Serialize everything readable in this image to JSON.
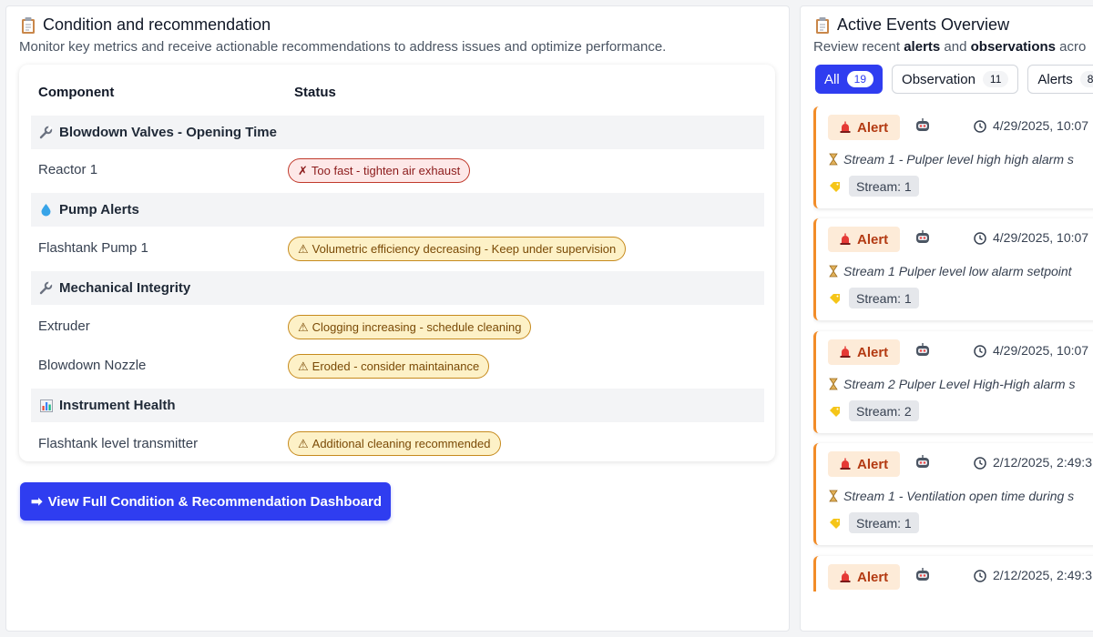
{
  "left": {
    "title": "Condition and recommendation",
    "subtitle": "Monitor key metrics and receive actionable recommendations to address issues and optimize performance.",
    "columns": {
      "component": "Component",
      "status": "Status"
    },
    "groups": [
      {
        "label": "Blowdown Valves - Opening Time",
        "icon": "wrench-icon"
      },
      {
        "label": "Pump Alerts",
        "icon": "droplet-icon"
      },
      {
        "label": "Mechanical Integrity",
        "icon": "wrench-icon"
      },
      {
        "label": "Instrument Health",
        "icon": "bar-chart-icon"
      }
    ],
    "rows": [
      {
        "component": "Reactor 1",
        "status": "Too fast - tighten air exhaust",
        "level": "error",
        "icon": "x-icon"
      },
      {
        "component": "Flashtank Pump 1",
        "status": "Volumetric efficiency decreasing - Keep under supervision",
        "level": "warning",
        "icon": "warning-icon"
      },
      {
        "component": "Extruder",
        "status": "Clogging increasing - schedule cleaning",
        "level": "warning",
        "icon": "warning-icon"
      },
      {
        "component": "Blowdown Nozzle",
        "status": "Eroded - consider maintainance",
        "level": "warning",
        "icon": "warning-icon"
      },
      {
        "component": "Flashtank level transmitter",
        "status": "Additional cleaning recommended",
        "level": "warning",
        "icon": "warning-icon"
      }
    ],
    "button_label": "View Full Condition & Recommendation Dashboard",
    "button_icon": "arrow-right-icon"
  },
  "right": {
    "title": "Active Events Overview",
    "subtitle_prefix": "Review recent ",
    "subtitle_bold1": "alerts",
    "subtitle_mid": " and ",
    "subtitle_bold2": "observations",
    "subtitle_suffix": " acro",
    "tabs": [
      {
        "label": "All",
        "count": "19",
        "active": true
      },
      {
        "label": "Observation",
        "count": "11",
        "active": false
      },
      {
        "label": "Alerts",
        "count": "8",
        "active": false
      }
    ],
    "events": [
      {
        "badge": "Alert",
        "time": "4/29/2025, 10:07",
        "desc": "Stream 1 - Pulper level high high alarm s",
        "stream": "Stream: 1"
      },
      {
        "badge": "Alert",
        "time": "4/29/2025, 10:07",
        "desc": "Stream 1 Pulper level low alarm setpoint",
        "stream": "Stream: 1"
      },
      {
        "badge": "Alert",
        "time": "4/29/2025, 10:07",
        "desc": "Stream 2 Pulper Level High-High alarm s",
        "stream": "Stream: 2"
      },
      {
        "badge": "Alert",
        "time": "2/12/2025, 2:49:3",
        "desc": "Stream 1 - Ventilation open time during s",
        "stream": "Stream: 1"
      },
      {
        "badge": "Alert",
        "time": "2/12/2025, 2:49:3",
        "desc": "",
        "stream": ""
      }
    ]
  },
  "colors": {
    "primary": "#2f3df0",
    "alert_accent": "#f28c28",
    "error_bg": "#fde8e8",
    "warning_bg": "#fdf1c7"
  }
}
